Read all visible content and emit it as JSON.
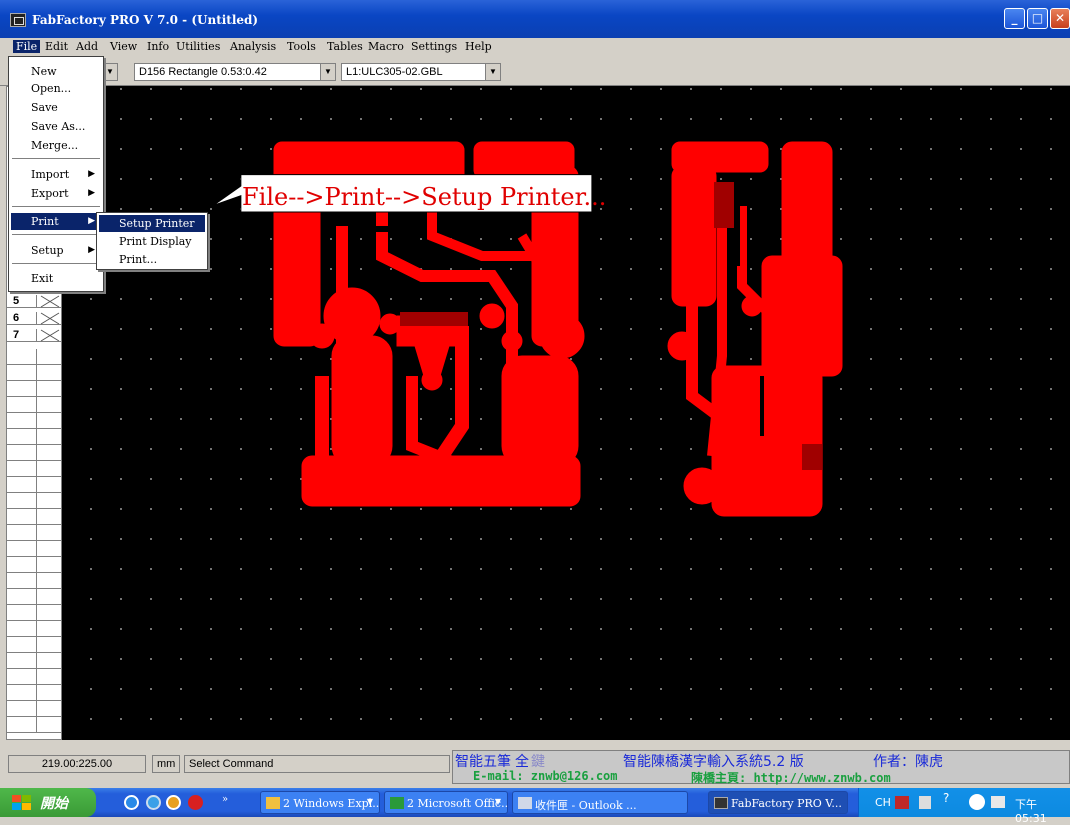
{
  "window": {
    "title": "FabFactory PRO V 7.0 - (Untitled)"
  },
  "menubar": [
    "File",
    "Edit",
    "Add",
    "View",
    "Info",
    "Utilities",
    "Analysis",
    "Tools",
    "Tables",
    "Macro",
    "Settings",
    "Help"
  ],
  "toolbar": {
    "dcode": "D156  Rectangle 0.53:0.42",
    "layer": "L1:ULC305-02.GBL"
  },
  "file_menu": {
    "new": "New",
    "open": "Open...",
    "save": "Save",
    "save_as": "Save As...",
    "merge": "Merge...",
    "import": "Import",
    "export": "Export",
    "print": "Print",
    "setup": "Setup",
    "exit": "Exit"
  },
  "print_submenu": {
    "setup_printer": "Setup Printer",
    "print_display": "Print Display",
    "print": "Print..."
  },
  "callout": "File-->Print-->Setup Printer...",
  "layer_rows": [
    "5",
    "6",
    "7"
  ],
  "colors": {
    "trace": "#ff0000",
    "canvas": "#000000",
    "highlight": "#0a246a"
  },
  "status": {
    "coords": "219.00:225.00",
    "units": "mm",
    "command": "Select Command",
    "ime_line1_a": "智能五筆",
    "ime_line1_b": "全",
    "ime_line1_c": "鍵",
    "ime_line1_d": "智能陳橋漢字輸入系統5.2 版",
    "ime_line1_e": "作者：陳虎",
    "ime_line2_a": "E-mail: znwb@126.com",
    "ime_line2_b": "陳橋主頁: http://www.znwb.com"
  },
  "taskbar": {
    "start": "開始",
    "tasks": [
      "2 Windows Expl...",
      "2 Microsoft Offic...",
      "收件匣 - Outlook ...",
      "FabFactory PRO V..."
    ],
    "tray_lang": "CH",
    "clock": "下午 05:31"
  }
}
